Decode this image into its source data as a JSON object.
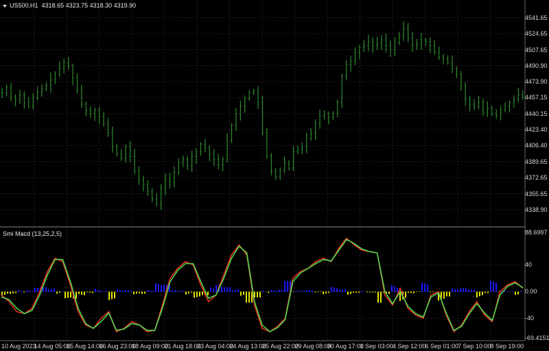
{
  "chart_header": {
    "symbol_timeframe": "US500,H1",
    "ohlc": "4318.65 4323.75 4318.30 4319.90"
  },
  "indicator_header": {
    "label": "Smi Macd (13,25,2,5)"
  },
  "price_axis": {
    "ticks": [
      "4541.65",
      "4524.65",
      "4507.65",
      "4490.90",
      "4473.90",
      "4457.15",
      "4440.15",
      "4423.40",
      "4406.40",
      "4389.65",
      "4372.65",
      "4355.65",
      "4338.90"
    ],
    "range": [
      4330,
      4550
    ]
  },
  "indicator_axis": {
    "ticks": [
      "88.6997",
      "40",
      "0.00",
      "-40",
      "-69.4151"
    ],
    "range": [
      -69.4151,
      88.6997
    ]
  },
  "time_axis": {
    "labels": [
      "10 Aug 2023",
      "14 Aug 05:00",
      "15 Aug 14:00",
      "16 Aug 23:00",
      "18 Aug 09:00",
      "21 Aug 18:00",
      "23 Aug 04:00",
      "24 Aug 13:00",
      "25 Aug 22:00",
      "29 Aug 08:00",
      "30 Aug 17:00",
      "1 Sep 03:00",
      "4 Sep 12:00",
      "6 Sep 01:00",
      "7 Sep 10:00",
      "8 Sep 19:00"
    ]
  },
  "colors": {
    "background": "#000000",
    "grid": "#3a3a3a",
    "candles": "#2e8b2e",
    "signal_line": "#e8302a",
    "smi_line": "#4fd84f",
    "histogram_positive": "#1a1aff",
    "histogram_negative": "#e6e600",
    "separator": "#8a8a8a"
  },
  "chart_data": [
    {
      "type": "candlestick",
      "series": [
        {
          "name": "US500,H1",
          "values": [
            4462,
            4468,
            4458,
            4455,
            4460,
            4452,
            4448,
            4457,
            4463,
            4466,
            4470,
            4476,
            4482,
            4488,
            4494,
            4490,
            4478,
            4465,
            4450,
            4444,
            4440,
            4444,
            4437,
            4430,
            4420,
            4405,
            4398,
            4393,
            4405,
            4395,
            4380,
            4370,
            4365,
            4358,
            4350,
            4345,
            4362,
            4370,
            4368,
            4378,
            4388,
            4392,
            4385,
            4395,
            4400,
            4408,
            4404,
            4398,
            4392,
            4386,
            4392,
            4412,
            4428,
            4440,
            4448,
            4456,
            4462,
            4464,
            4452,
            4420,
            4395,
            4380,
            4374,
            4380,
            4388,
            4382,
            4400,
            4402,
            4405,
            4418,
            4420,
            4430,
            4438,
            4440,
            4436,
            4440,
            4452,
            4480,
            4492,
            4496,
            4505,
            4510,
            4512,
            4516,
            4512,
            4514,
            4518,
            4512,
            4508,
            4515,
            4522,
            4530,
            4520,
            4512,
            4514,
            4518,
            4516,
            4512,
            4505,
            4500,
            4498,
            4494,
            4488,
            4482,
            4470,
            4455,
            4450,
            4448,
            4452,
            4442,
            4446,
            4440,
            4438,
            4444,
            4448,
            4452,
            4455,
            4460,
            4458
          ]
        }
      ]
    },
    {
      "type": "line",
      "series": [
        {
          "name": "",
          "values": [
            -5,
            -15,
            -30,
            -33,
            -25,
            0,
            30,
            50,
            45,
            10,
            -30,
            -50,
            -55,
            -40,
            -30,
            -60,
            -55,
            -45,
            -50,
            -60,
            -58,
            -20,
            20,
            35,
            45,
            40,
            10,
            -15,
            -5,
            25,
            55,
            70,
            55,
            -20,
            -55,
            -60,
            -52,
            -40,
            20,
            30,
            35,
            45,
            50,
            45,
            65,
            80,
            70,
            62,
            60,
            58,
            -5,
            -20,
            5,
            -25,
            -35,
            -40,
            -5,
            0,
            -35,
            -60,
            -50,
            -30,
            -15,
            -35,
            -45,
            0,
            10,
            15,
            5
          ]
        },
        {
          "name": "",
          "values": [
            -8,
            -12,
            -25,
            -33,
            -28,
            -5,
            25,
            48,
            48,
            15,
            -25,
            -48,
            -55,
            -45,
            -32,
            -58,
            -56,
            -48,
            -50,
            -58,
            -58,
            -25,
            15,
            32,
            42,
            42,
            15,
            -10,
            -5,
            20,
            50,
            68,
            58,
            -15,
            -50,
            -60,
            -54,
            -42,
            15,
            28,
            35,
            42,
            48,
            46,
            62,
            78,
            72,
            64,
            60,
            58,
            0,
            -18,
            0,
            -22,
            -33,
            -38,
            -8,
            -2,
            -32,
            -58,
            -52,
            -33,
            -18,
            -32,
            -43,
            -5,
            8,
            13,
            6
          ]
        }
      ]
    }
  ]
}
